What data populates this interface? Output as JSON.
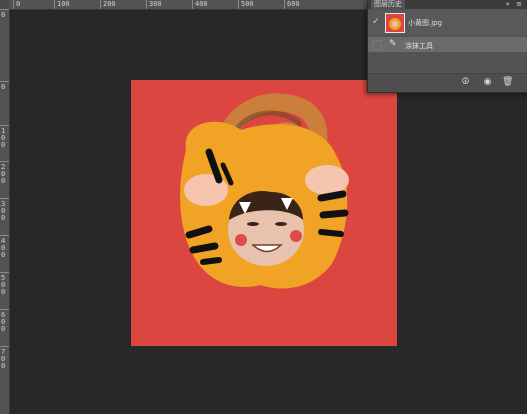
{
  "rulers": {
    "top_labels": [
      "0",
      "50",
      "100",
      "150",
      "200",
      "250",
      "300",
      "350",
      "400",
      "450",
      "500",
      "550",
      "600"
    ],
    "left_labels": [
      "0",
      "0",
      "1 0 0",
      "2 0 0",
      "3 0 0",
      "4 0 0",
      "5 0 0",
      "6 0 0",
      "7 0 0",
      "8 0 0"
    ]
  },
  "canvas": {
    "background_color": "#dc4640",
    "image_description_icon": "tiger-costume-photo"
  },
  "layers_panel": {
    "tab_label": "图层历史",
    "controls": "» ≡",
    "layers": [
      {
        "name": "小黄图.jpg",
        "visible": true,
        "thumbnail": "tiger-thumbnail-icon"
      },
      {
        "name": "涂抹工具",
        "visible": false,
        "thumbnail": "smudge-brush-icon"
      }
    ],
    "footer_icons": [
      "adjustment-icon",
      "camera-icon",
      "trash-icon"
    ]
  },
  "colors": {
    "workspace": "#282828",
    "ruler": "#535353",
    "panel": "#535353",
    "selected_layer": "#6b6b6b"
  }
}
